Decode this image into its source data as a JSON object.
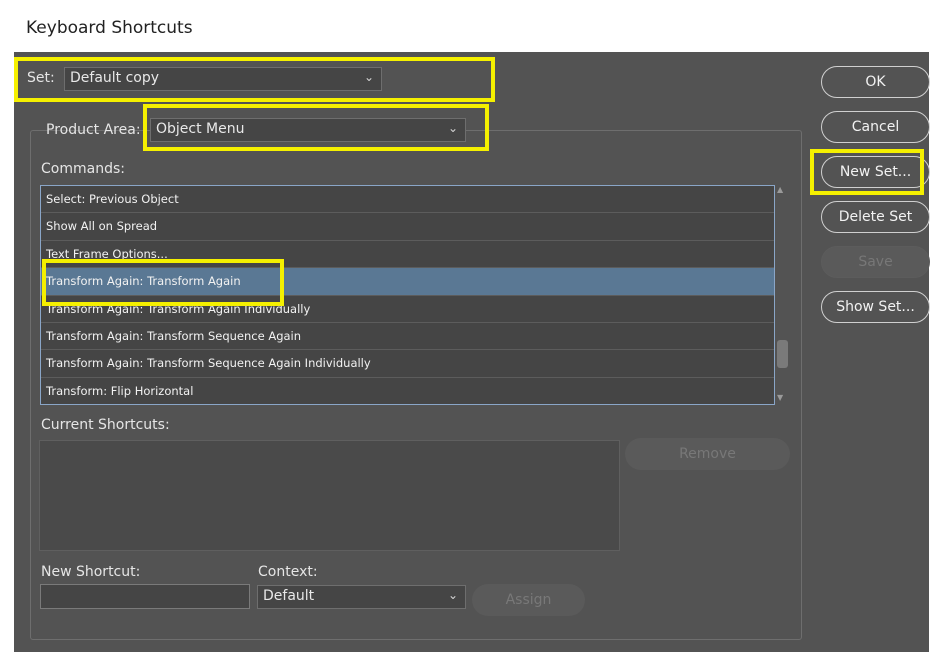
{
  "window": {
    "title": "Keyboard Shortcuts"
  },
  "set": {
    "label": "Set:",
    "value": "Default copy"
  },
  "product_area": {
    "label": "Product Area:",
    "value": "Object Menu"
  },
  "commands": {
    "label": "Commands:",
    "items": [
      "Select: Previous Object",
      "Show All on Spread",
      "Text Frame Options...",
      "Transform Again: Transform Again",
      "Transform Again: Transform Again Individually",
      "Transform Again: Transform Sequence Again",
      "Transform Again: Transform Sequence Again Individually",
      "Transform: Flip Horizontal"
    ],
    "selected_index": 3
  },
  "current_shortcuts": {
    "label": "Current Shortcuts:"
  },
  "new_shortcut": {
    "label": "New Shortcut:",
    "value": ""
  },
  "context": {
    "label": "Context:",
    "value": "Default"
  },
  "buttons": {
    "ok": "OK",
    "cancel": "Cancel",
    "new_set": "New Set...",
    "delete_set": "Delete Set",
    "save": "Save",
    "show_set": "Show Set...",
    "remove": "Remove",
    "assign": "Assign"
  },
  "colors": {
    "dialog_bg": "#535353",
    "selection": "#5a7894",
    "highlight": "#f5f000"
  },
  "icons": {
    "dropdown": "chevron-down-icon",
    "scroll_up": "scroll-up-icon",
    "scroll_down": "scroll-down-icon"
  }
}
